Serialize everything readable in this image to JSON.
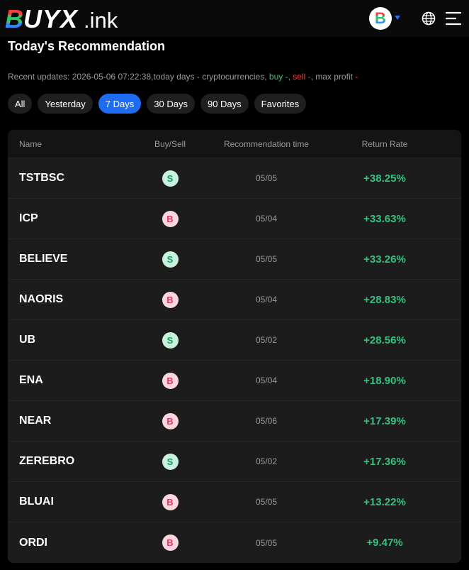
{
  "header": {
    "logo_b": "B",
    "logo_rest": "UYX",
    "logo_ink": ".ink",
    "avatar_letter": "B"
  },
  "page_title": "Today's Recommendation",
  "updates": {
    "prefix": "Recent updates: 2026-05-06 07:22:38,today days - cryptocurrencies, ",
    "buy": "buy -",
    "sep1": ", ",
    "sell": "sell -",
    "middle": ", max profit ",
    "profit": "-"
  },
  "filters": [
    {
      "label": "All",
      "active": false
    },
    {
      "label": "Yesterday",
      "active": false
    },
    {
      "label": "7 Days",
      "active": true
    },
    {
      "label": "30 Days",
      "active": false
    },
    {
      "label": "90 Days",
      "active": false
    },
    {
      "label": "Favorites",
      "active": false
    }
  ],
  "table": {
    "headers": {
      "name": "Name",
      "buysell": "Buy/Sell",
      "time": "Recommendation time",
      "rate": "Return Rate"
    },
    "rows": [
      {
        "name": "TSTBSC",
        "type": "S",
        "time": "05/05",
        "rate": "+38.25%"
      },
      {
        "name": "ICP",
        "type": "B",
        "time": "05/04",
        "rate": "+33.63%"
      },
      {
        "name": "BELIEVE",
        "type": "S",
        "time": "05/05",
        "rate": "+33.26%"
      },
      {
        "name": "NAORIS",
        "type": "B",
        "time": "05/04",
        "rate": "+28.83%"
      },
      {
        "name": "UB",
        "type": "S",
        "time": "05/02",
        "rate": "+28.56%"
      },
      {
        "name": "ENA",
        "type": "B",
        "time": "05/04",
        "rate": "+18.90%"
      },
      {
        "name": "NEAR",
        "type": "B",
        "time": "05/06",
        "rate": "+17.39%"
      },
      {
        "name": "ZEREBRO",
        "type": "S",
        "time": "05/02",
        "rate": "+17.36%"
      },
      {
        "name": "BLUAI",
        "type": "B",
        "time": "05/05",
        "rate": "+13.22%"
      },
      {
        "name": "ORDI",
        "type": "B",
        "time": "05/05",
        "rate": "+9.47%"
      }
    ]
  },
  "colors": {
    "accent": "#1e6cf2",
    "buy_green": "#35c27f",
    "sell_red": "#ef3b3b",
    "return_green": "#36c17f"
  },
  "icons": {
    "language": "globe-icon",
    "menu": "menu-icon",
    "dropdown": "caret-down-icon"
  }
}
